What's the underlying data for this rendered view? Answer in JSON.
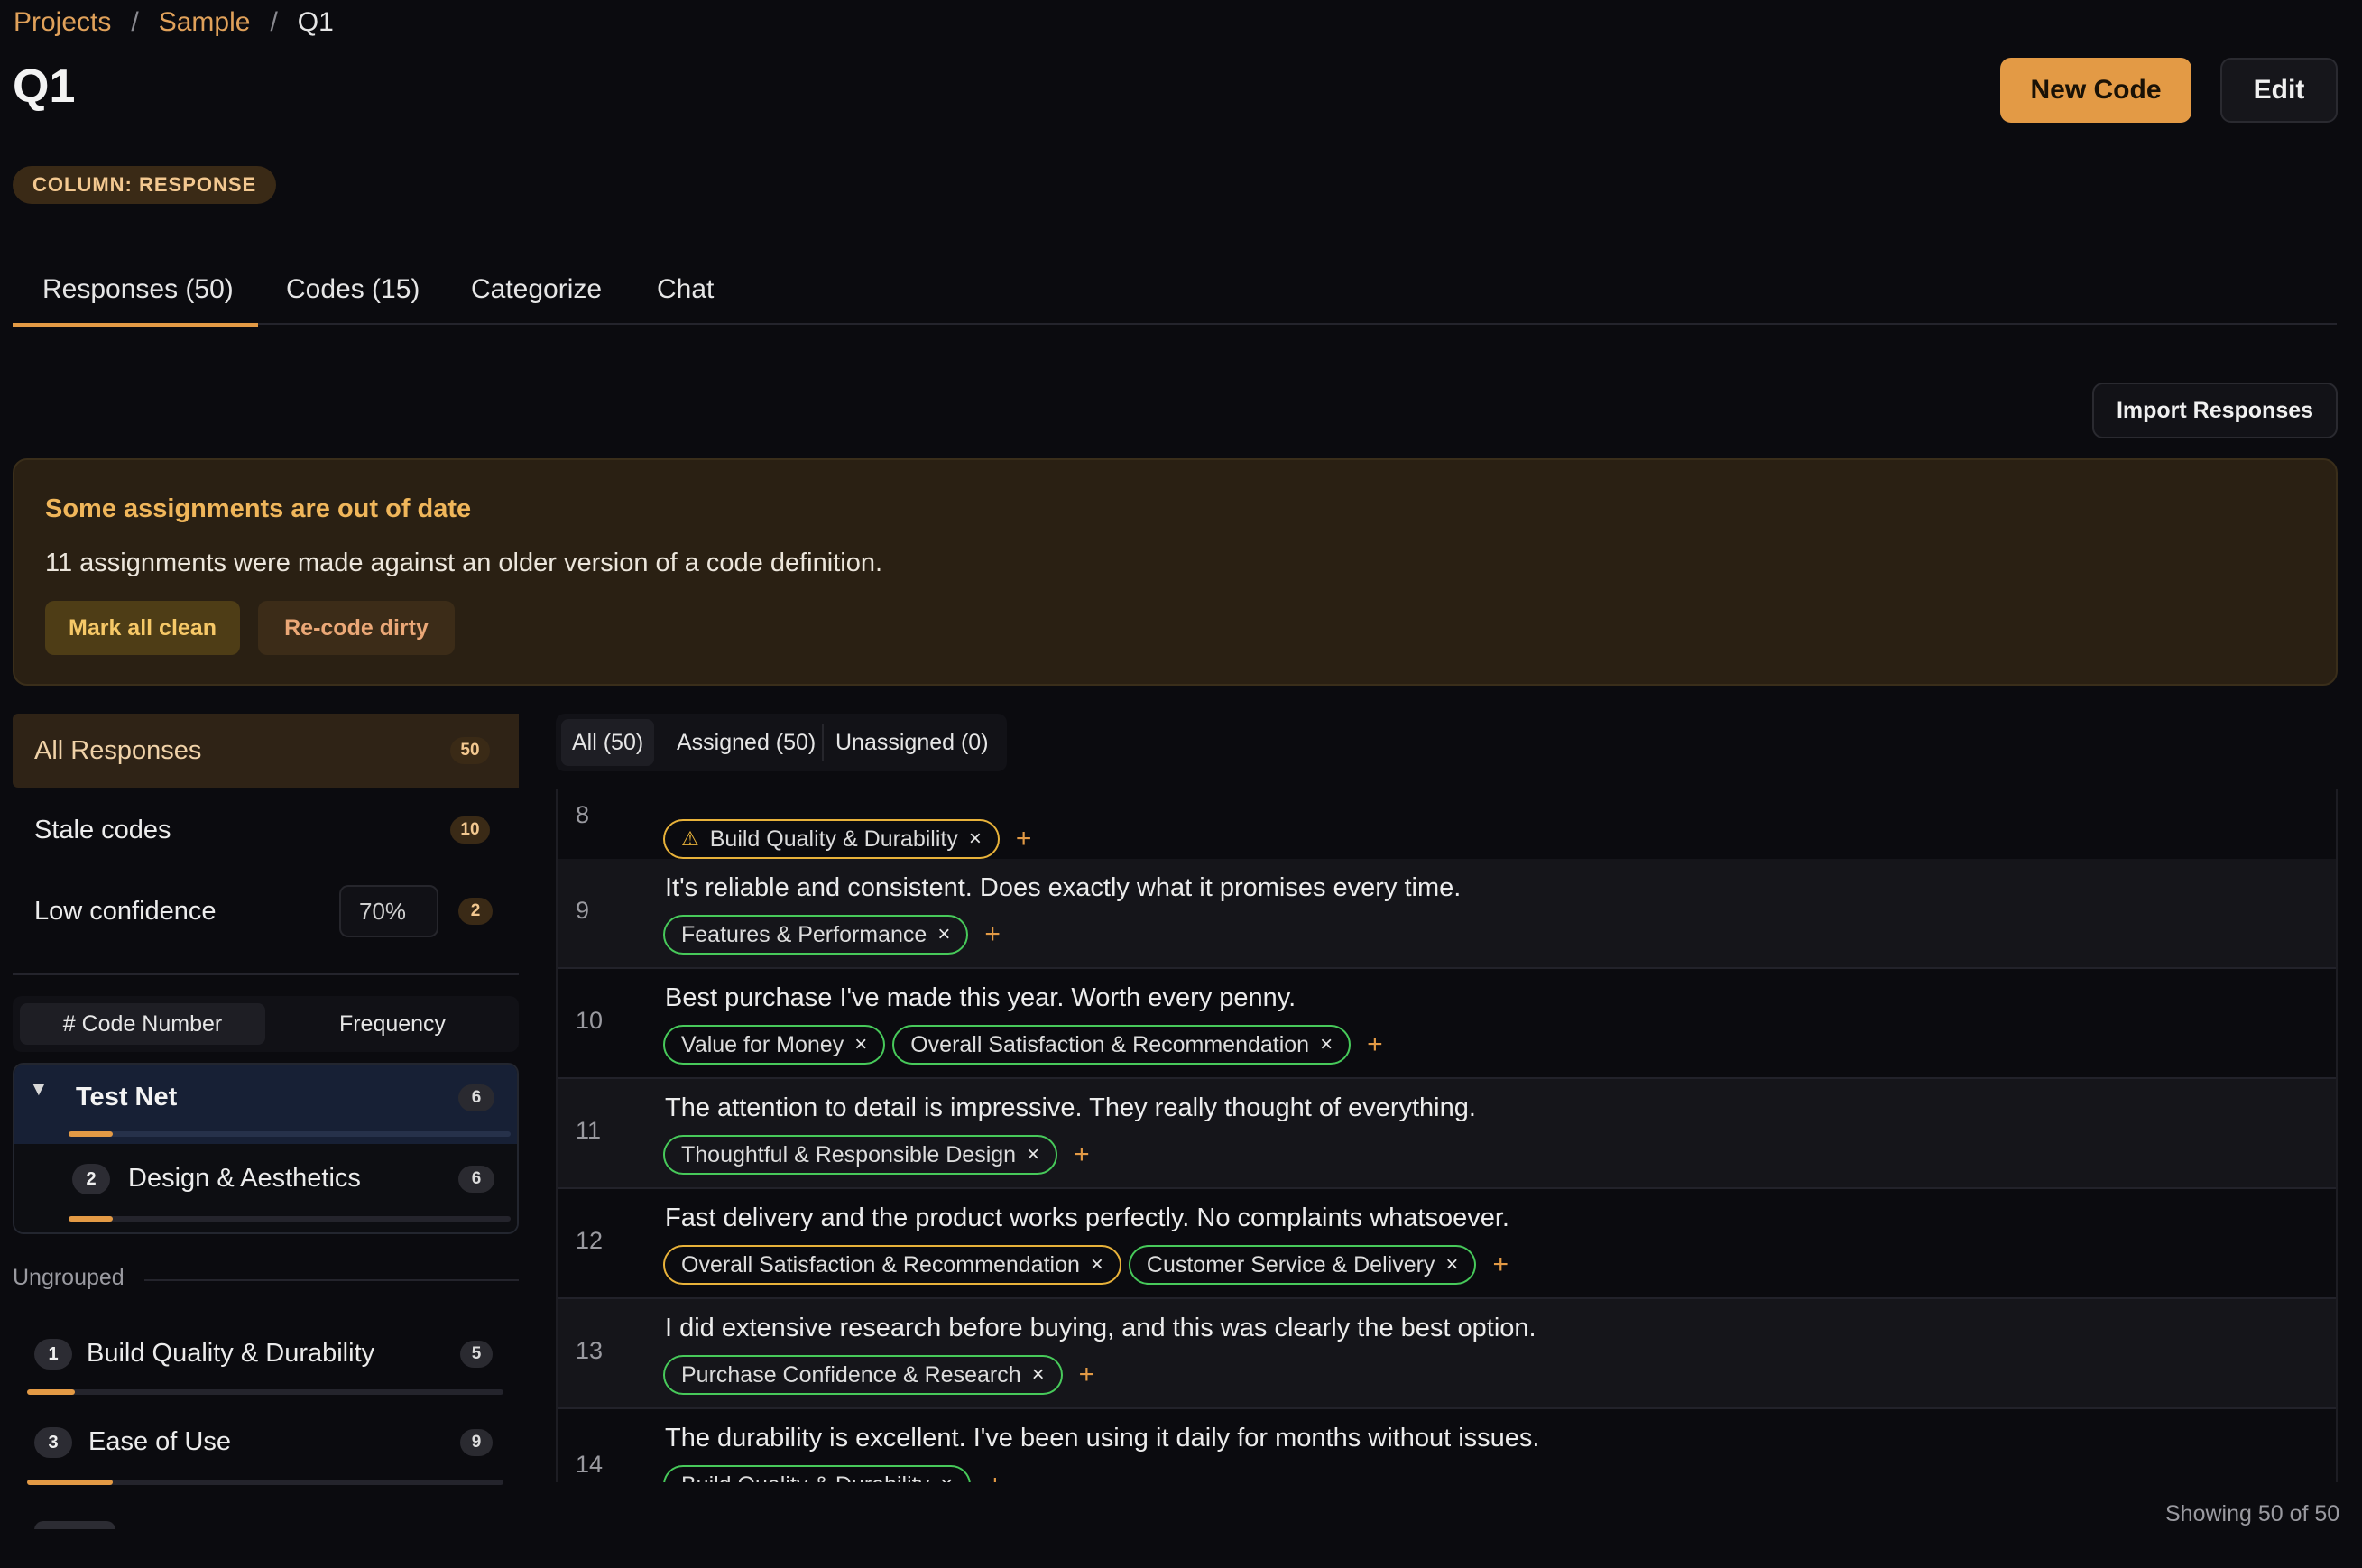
{
  "breadcrumb": {
    "projects": "Projects",
    "sample": "Sample",
    "current": "Q1",
    "sep": "/"
  },
  "page": {
    "title": "Q1",
    "column_badge": "COLUMN: RESPONSE"
  },
  "header": {
    "new_code": "New Code",
    "edit": "Edit"
  },
  "tabs": {
    "responses": "Responses (50)",
    "codes": "Codes (15)",
    "categorize": "Categorize",
    "chat": "Chat"
  },
  "import_button": "Import Responses",
  "banner": {
    "title": "Some assignments are out of date",
    "text": "11 assignments were made against an older version of a code definition.",
    "mark_clean": "Mark all clean",
    "recode": "Re-code dirty"
  },
  "sidebar": {
    "all_label": "All Responses",
    "all_count": "50",
    "stale_label": "Stale codes",
    "stale_count": "10",
    "lowconf_label": "Low confidence",
    "lowconf_value": "70%",
    "lowconf_count": "2",
    "sort_code_number": "# Code Number",
    "sort_frequency": "Frequency",
    "net_name": "Test Net",
    "net_count": "6",
    "net_child_num": "2",
    "net_child_name": "Design & Aesthetics",
    "net_child_count": "6",
    "ungrouped": "Ungrouped",
    "ungrouped_items": [
      {
        "num": "1",
        "name": "Build Quality & Durability",
        "count": "5",
        "fill": 0.1
      },
      {
        "num": "3",
        "name": "Ease of Use",
        "count": "9",
        "fill": 0.18
      }
    ],
    "net_fill": 0.1,
    "net_child_fill": 0.1
  },
  "filters": {
    "all": "All (50)",
    "assigned": "Assigned (50)",
    "unassigned": "Unassigned (0)"
  },
  "rows": [
    {
      "num": "8",
      "text": "",
      "chips": [
        {
          "label": "Build Quality & Durability",
          "style": "amber",
          "warn": true
        }
      ]
    },
    {
      "num": "9",
      "text": "It's reliable and consistent. Does exactly what it promises every time.",
      "chips": [
        {
          "label": "Features & Performance",
          "style": "green"
        }
      ]
    },
    {
      "num": "10",
      "text": "Best purchase I've made this year. Worth every penny.",
      "chips": [
        {
          "label": "Value for Money",
          "style": "green"
        },
        {
          "label": "Overall Satisfaction & Recommendation",
          "style": "green"
        }
      ]
    },
    {
      "num": "11",
      "text": "The attention to detail is impressive. They really thought of everything.",
      "chips": [
        {
          "label": "Thoughtful & Responsible Design",
          "style": "green"
        }
      ]
    },
    {
      "num": "12",
      "text": "Fast delivery and the product works perfectly. No complaints whatsoever.",
      "chips": [
        {
          "label": "Overall Satisfaction & Recommendation",
          "style": "amber"
        },
        {
          "label": "Customer Service & Delivery",
          "style": "green"
        }
      ]
    },
    {
      "num": "13",
      "text": "I did extensive research before buying, and this was clearly the best option.",
      "chips": [
        {
          "label": "Purchase Confidence & Research",
          "style": "green"
        }
      ]
    },
    {
      "num": "14",
      "text": "The durability is excellent. I've been using it daily for months without issues.",
      "chips": [
        {
          "label": "Build Quality & Durability",
          "style": "green"
        }
      ]
    }
  ],
  "footer": {
    "showing": "Showing 50 of 50"
  },
  "icons": {
    "close": "×",
    "add": "+",
    "warning": "⚠",
    "caret": "▼"
  },
  "colors": {
    "accent": "#e39a45",
    "chip_green": "#47c95a",
    "chip_amber": "#e8b23a"
  }
}
